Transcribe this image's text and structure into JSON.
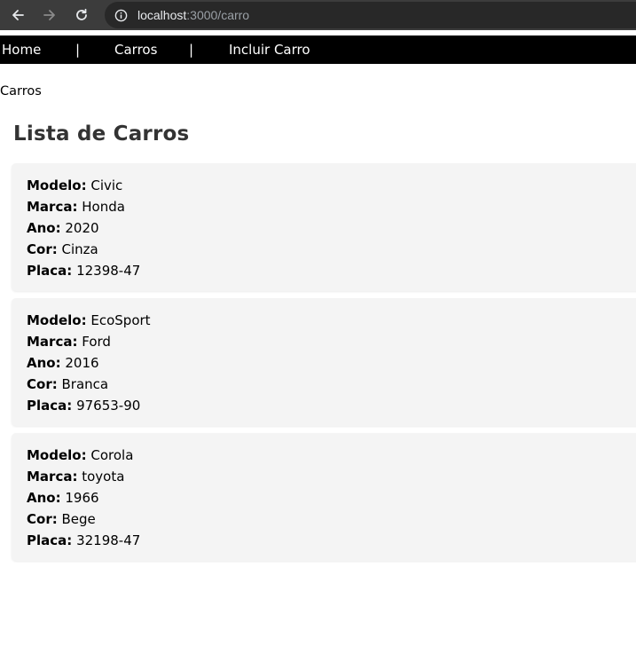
{
  "browser": {
    "url_host": "localhost",
    "url_path": ":3000/carro"
  },
  "nav": {
    "home": "Home",
    "separator": "|",
    "carros": "Carros",
    "incluir": "Incluir Carro"
  },
  "breadcrumb": "Carros",
  "page_title": "Lista de Carros",
  "field_labels": {
    "modelo": "Modelo:",
    "marca": "Marca:",
    "ano": "Ano:",
    "cor": "Cor:",
    "placa": "Placa:"
  },
  "cars": [
    {
      "modelo": "Civic",
      "marca": "Honda",
      "ano": "2020",
      "cor": "Cinza",
      "placa": "12398-47"
    },
    {
      "modelo": "EcoSport",
      "marca": "Ford",
      "ano": "2016",
      "cor": "Branca",
      "placa": "97653-90"
    },
    {
      "modelo": "Corola",
      "marca": "toyota",
      "ano": "1966",
      "cor": "Bege",
      "placa": "32198-47"
    }
  ]
}
